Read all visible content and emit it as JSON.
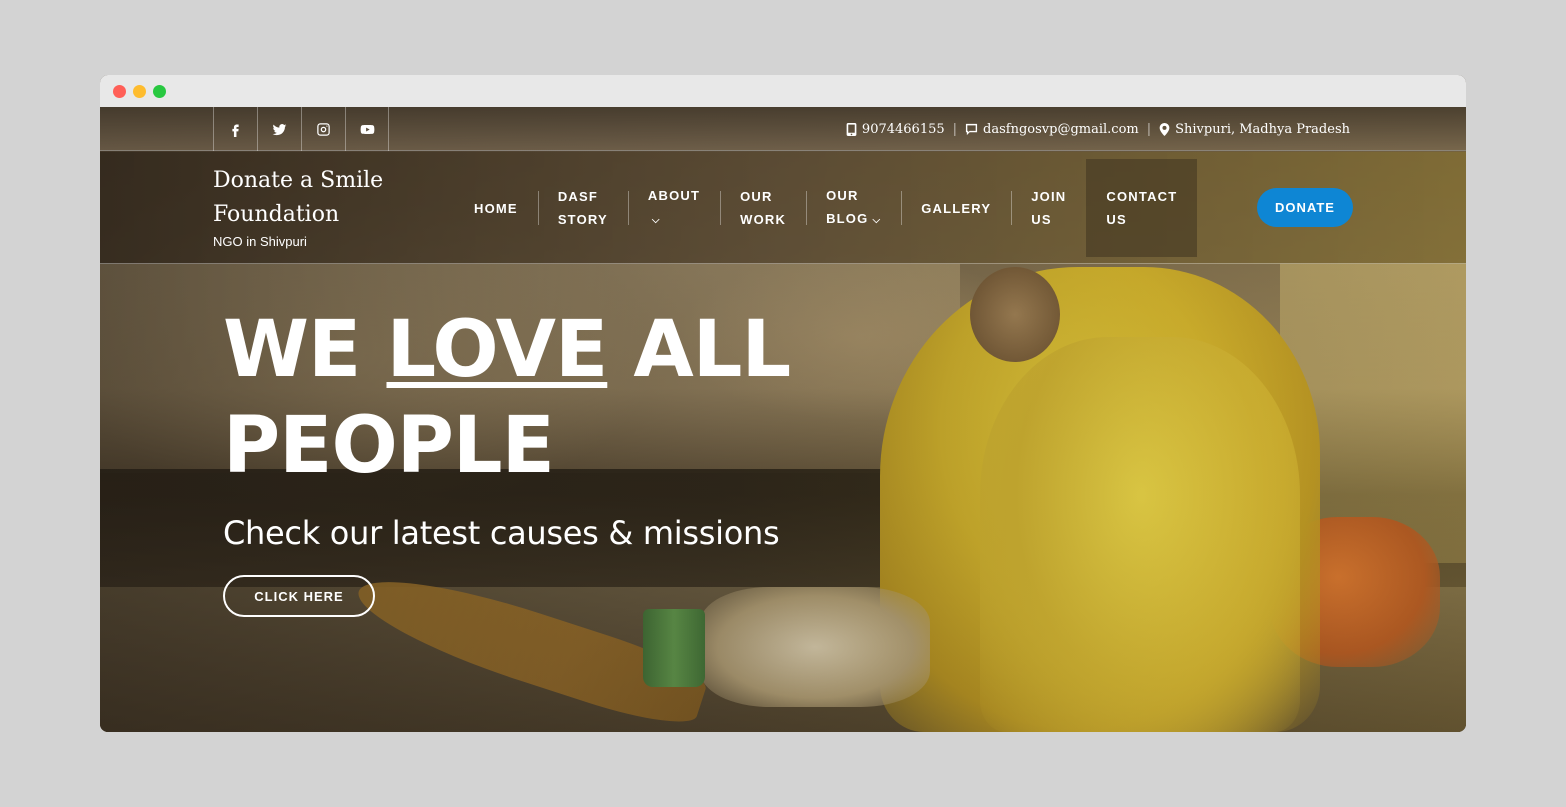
{
  "topbar": {
    "social": [
      {
        "icon": "facebook-icon"
      },
      {
        "icon": "twitter-icon"
      },
      {
        "icon": "instagram-icon"
      },
      {
        "icon": "youtube-icon"
      }
    ],
    "phone": "9074466155",
    "email": "dasfngosvp@gmail.com",
    "location": "Shivpuri, Madhya Pradesh"
  },
  "brand": {
    "name": "Donate a Smile Foundation",
    "tagline": "NGO in Shivpuri"
  },
  "nav": {
    "items": [
      {
        "line1": "HOME",
        "line2": ""
      },
      {
        "line1": "DASF",
        "line2": "STORY"
      },
      {
        "line1": "ABOUT",
        "line2": ""
      },
      {
        "line1": "OUR",
        "line2": "WORK"
      },
      {
        "line1": "OUR",
        "line2": "BLOG"
      },
      {
        "line1": "GALLERY",
        "line2": ""
      },
      {
        "line1": "JOIN",
        "line2": "US"
      },
      {
        "line1": "CONTACT",
        "line2": "US"
      }
    ],
    "donate": "DONATE"
  },
  "hero": {
    "headline_a": "WE ",
    "headline_b": "LOVE",
    "headline_c": " ALL",
    "headline_d": "PEOPLE",
    "subline": "Check our latest causes & missions",
    "cta": "CLICK HERE"
  },
  "colors": {
    "donate_button": "#0e86d4",
    "text": "#ffffff"
  }
}
